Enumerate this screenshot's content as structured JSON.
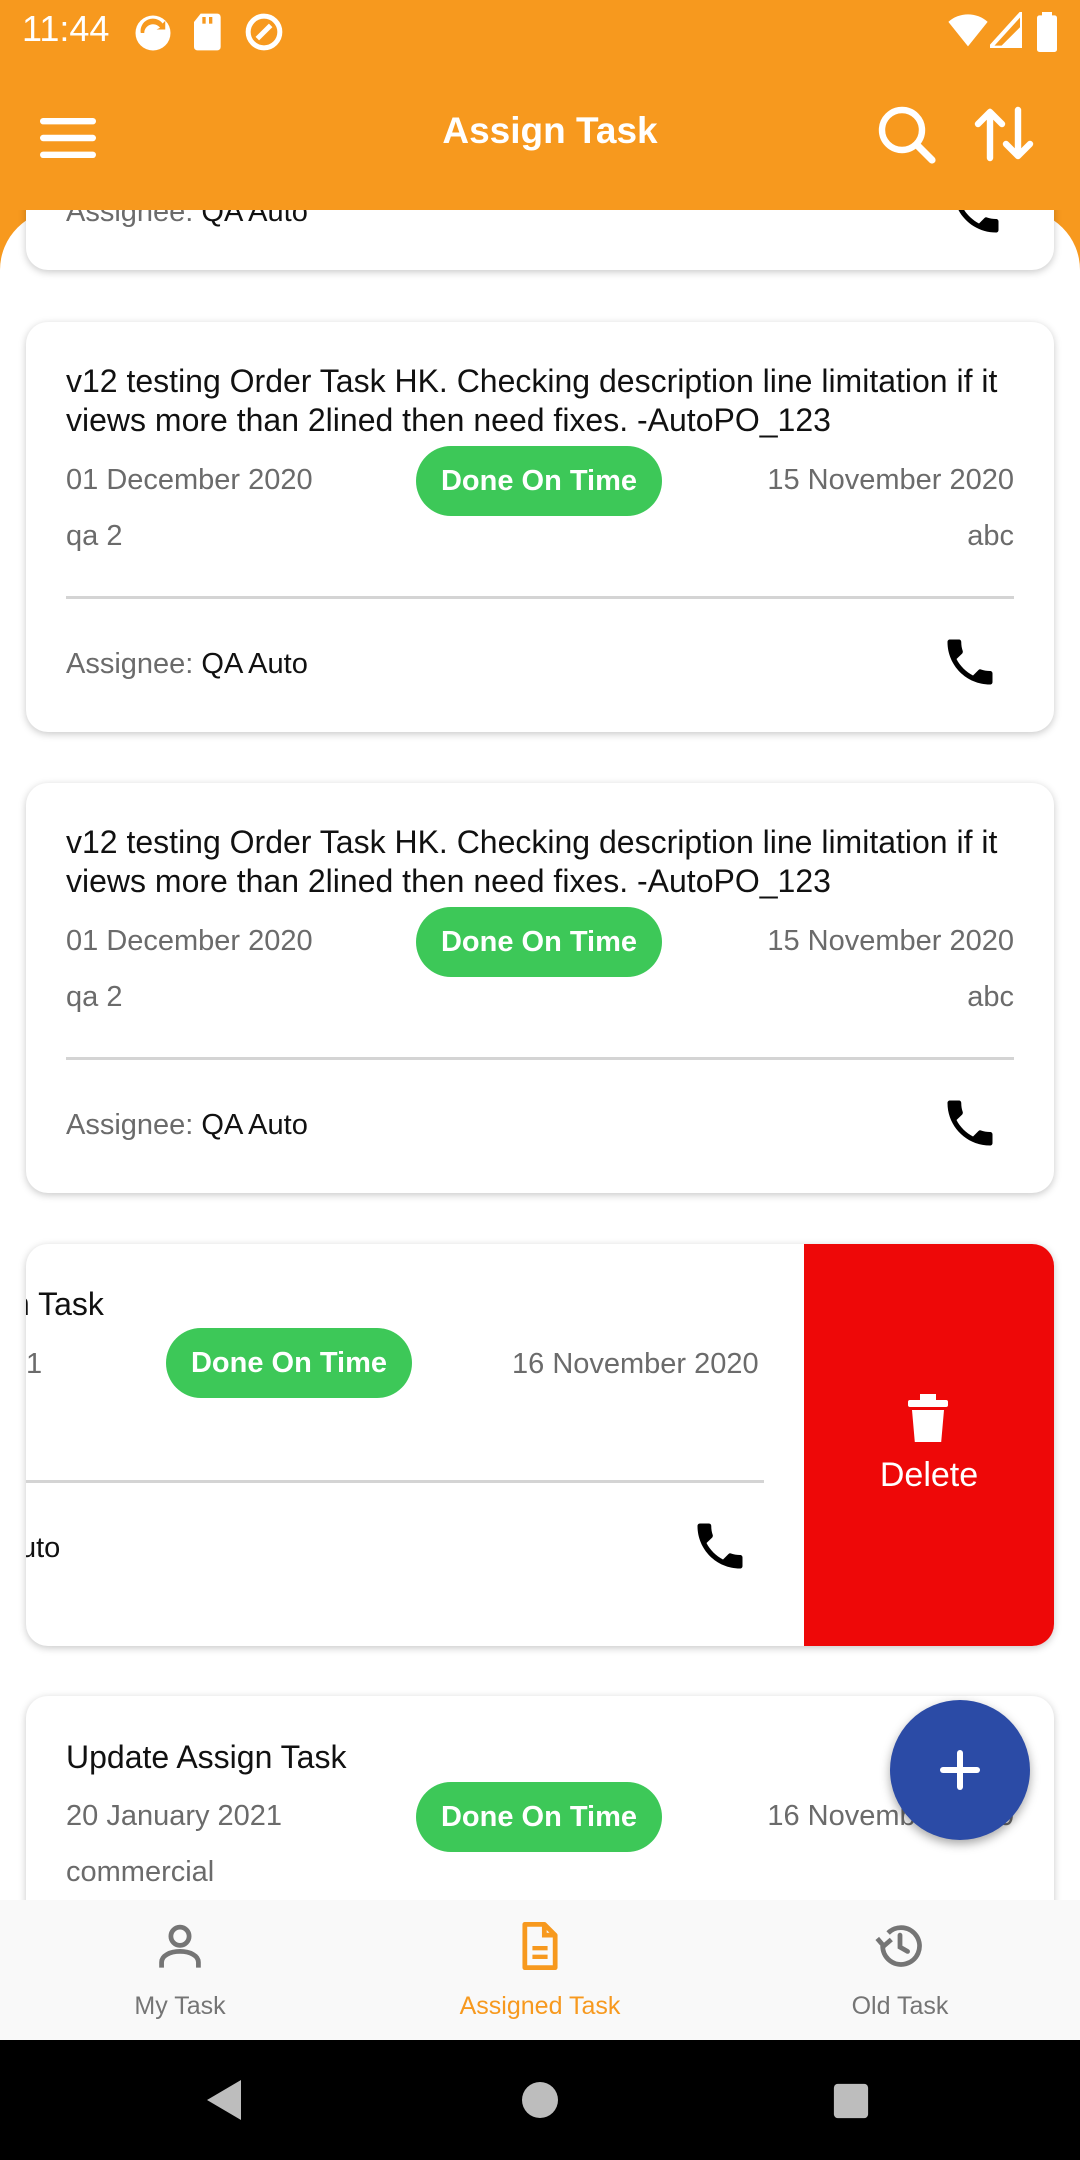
{
  "status_bar": {
    "time": "11:44"
  },
  "app_bar": {
    "title": "Assign Task"
  },
  "tasks": [
    {
      "description": "v12 testing Order Task HK. Checking description line limitation if it views more than 2lined then need fixes. -AutoPO_123",
      "start_date": "01 December 2020",
      "status": "Done On Time",
      "end_date": "15 November 2020",
      "created_by": "qa 2",
      "category": "abc",
      "assignee_label": "Assignee:",
      "assignee": "QA Auto"
    },
    {
      "description": "v12 testing Order Task HK. Checking description line limitation if it views more than 2lined then need fixes. -AutoPO_123",
      "start_date": "01 December 2020",
      "status": "Done On Time",
      "end_date": "15 November 2020",
      "created_by": "qa 2",
      "category": "abc",
      "assignee_label": "Assignee:",
      "assignee": "QA Auto"
    }
  ],
  "top_partial_card": {
    "assignee_label": "Assignee:",
    "assignee": "QA Auto"
  },
  "swiped_card": {
    "title_fragment": "n Task",
    "date_fragment": "1",
    "status": "Done On Time",
    "end_date": "16 November 2020",
    "assignee_fragment": "uto",
    "delete_label": "Delete"
  },
  "last_card": {
    "title": "Update Assign Task",
    "start_date": "20 January 2021",
    "status": "Done On Time",
    "end_date": "16 November 2020",
    "created_by": "commercial"
  },
  "bottom_nav": [
    {
      "label": "My Task",
      "icon": "person-icon",
      "active": false
    },
    {
      "label": "Assigned Task",
      "icon": "document-icon",
      "active": true
    },
    {
      "label": "Old Task",
      "icon": "history-icon",
      "active": false
    }
  ],
  "colors": {
    "primary": "#F7991E",
    "status_green": "#3DC858",
    "delete_red": "#EE0808",
    "fab_blue": "#2B4BA6",
    "nav_inactive": "#757575"
  }
}
